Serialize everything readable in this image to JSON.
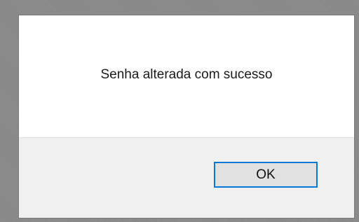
{
  "dialog": {
    "message": "Senha alterada com sucesso",
    "ok_label": "OK"
  }
}
